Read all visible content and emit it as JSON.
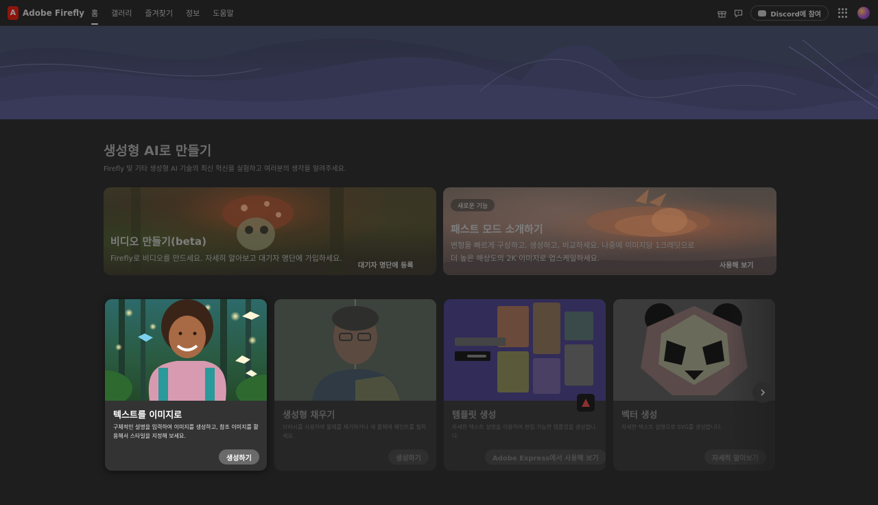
{
  "brand": {
    "name": "Adobe Firefly",
    "color": "#eb1000"
  },
  "nav": {
    "links": [
      {
        "label": "홈",
        "active": true
      },
      {
        "label": "갤러리",
        "active": false
      },
      {
        "label": "즐겨찾기",
        "active": false
      },
      {
        "label": "정보",
        "active": false
      },
      {
        "label": "도움말",
        "active": false
      }
    ],
    "icons": [
      "gift-icon",
      "feedback-icon"
    ],
    "discord_label": "Discord에 참여"
  },
  "section": {
    "title": "생성형 AI로 만들기",
    "subtitle": "Firefly 및 기타 생성형 AI 기술의 최신 혁신을 실험하고 여러분의 생각을 알려주세요."
  },
  "promos": {
    "video": {
      "title": "비디오 만들기(beta)",
      "text": "Firefly로 비디오를 만드세요. 자세히 알아보고 대기자 명단에 가입하세요.",
      "link": "대기자 명단에 등록"
    },
    "fast": {
      "badge": "새로운 기능",
      "title": "패스트 모드 소개하기",
      "text_line1": "변형을 빠르게 구상하고, 생성하고, 비교하세요. 나중에 이미지당 1크레딧으로",
      "text_line2": "더 높은 해상도의 2K 이미지로 업스케일하세요.",
      "link": "사용해 보기"
    }
  },
  "cards": [
    {
      "title": "텍스트를 이미지로",
      "desc": "구체적인 설명을 입력하여 이미지를 생성하고, 참조 이미지를 활용해서 스타일을 지정해 보세요.",
      "button": "생성하기"
    },
    {
      "title": "생성형 채우기",
      "desc": "브러시를 사용하여 물체를 제거하거나 새 물체에 페인트를 칠하세요.",
      "button": "생성하기"
    },
    {
      "title": "템플릿 생성",
      "desc": "자세한 텍스트 설명을 이용하여 편집 가능한 템플릿을 생성합니다.",
      "button": "Adobe Express에서 사용해 보기"
    },
    {
      "title": "벡터 생성",
      "desc": "자세한 텍스트 설명으로 SVG를 생성합니다.",
      "button": "자세히 알아보기"
    }
  ]
}
